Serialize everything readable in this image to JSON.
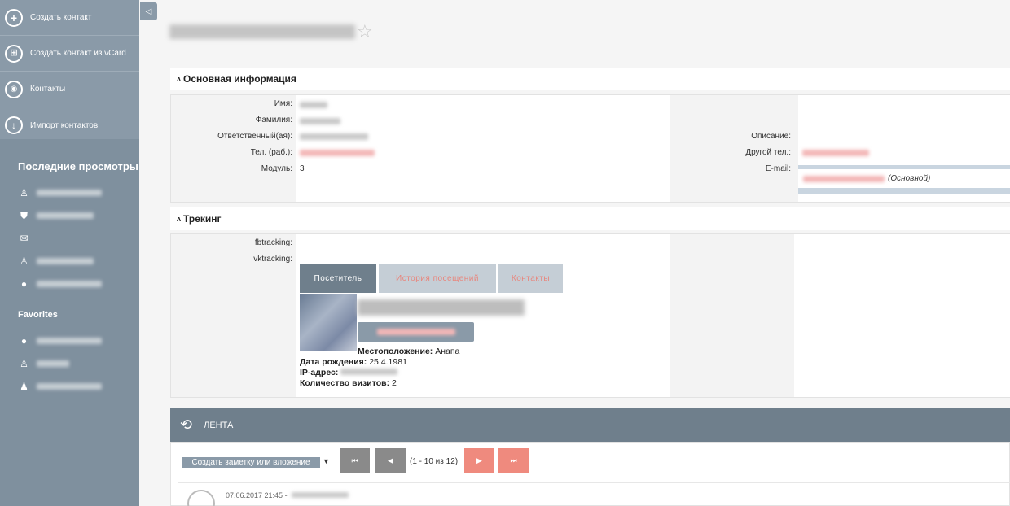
{
  "sidebar": {
    "actions": [
      {
        "label": "Создать контакт",
        "icon": "plus-circle-icon"
      },
      {
        "label": "Создать контакт из vCard",
        "icon": "vcard-plus-icon"
      },
      {
        "label": "Контакты",
        "icon": "eye-icon"
      },
      {
        "label": "Импорт контактов",
        "icon": "download-circle-icon"
      }
    ],
    "recent_heading": "Последние просмотры",
    "recent_icons": [
      "user-icon",
      "shield-icon",
      "mail-icon",
      "user-icon",
      "lightbulb-icon"
    ],
    "favorites_heading": "Favorites",
    "favorite_icons": [
      "lightbulb-icon",
      "user-icon",
      "users-icon"
    ]
  },
  "collapse_glyph": "◁",
  "star_glyph": "☆",
  "section_main": {
    "chevron": "ʌ",
    "title": "Основная информация",
    "fields": {
      "first_name_label": "Имя:",
      "last_name_label": "Фамилия:",
      "responsible_label": "Ответственный(ая):",
      "work_phone_label": "Тел. (раб.):",
      "module_label": "Модуль:",
      "module_value": "3",
      "description_label": "Описание:",
      "other_phone_label": "Другой тел.:",
      "email_label": "E-mail:",
      "email_primary_tag": "(Основной)"
    }
  },
  "section_tracking": {
    "chevron": "ʌ",
    "title": "Трекинг",
    "fbtracking_label": "fbtracking:",
    "vktracking_label": "vktracking:",
    "tabs": [
      "Посетитель",
      "История посещений",
      "Контакты"
    ],
    "location_label": "Местоположение:",
    "location_value": "Анапа",
    "birthdate_label": "Дата рождения:",
    "birthdate_value": "25.4.1981",
    "ip_label": "IP-адрес:",
    "visits_label": "Количество визитов:",
    "visits_value": "2"
  },
  "feed": {
    "title": "ЛЕНТА",
    "history_icon": "history-icon",
    "note_button": "Создать заметку или вложение",
    "note_caret": "▼",
    "pagination": {
      "first": "⏮",
      "prev": "◀",
      "info": "(1 - 10 из 12)",
      "next": "▶",
      "last": "⏭"
    },
    "item_date": "07.06.2017 21:45 -"
  },
  "colors": {
    "sidebar_bg": "#8a9aa8",
    "header_dark": "#6f7f8c",
    "accent_red": "#ef8a7e"
  }
}
